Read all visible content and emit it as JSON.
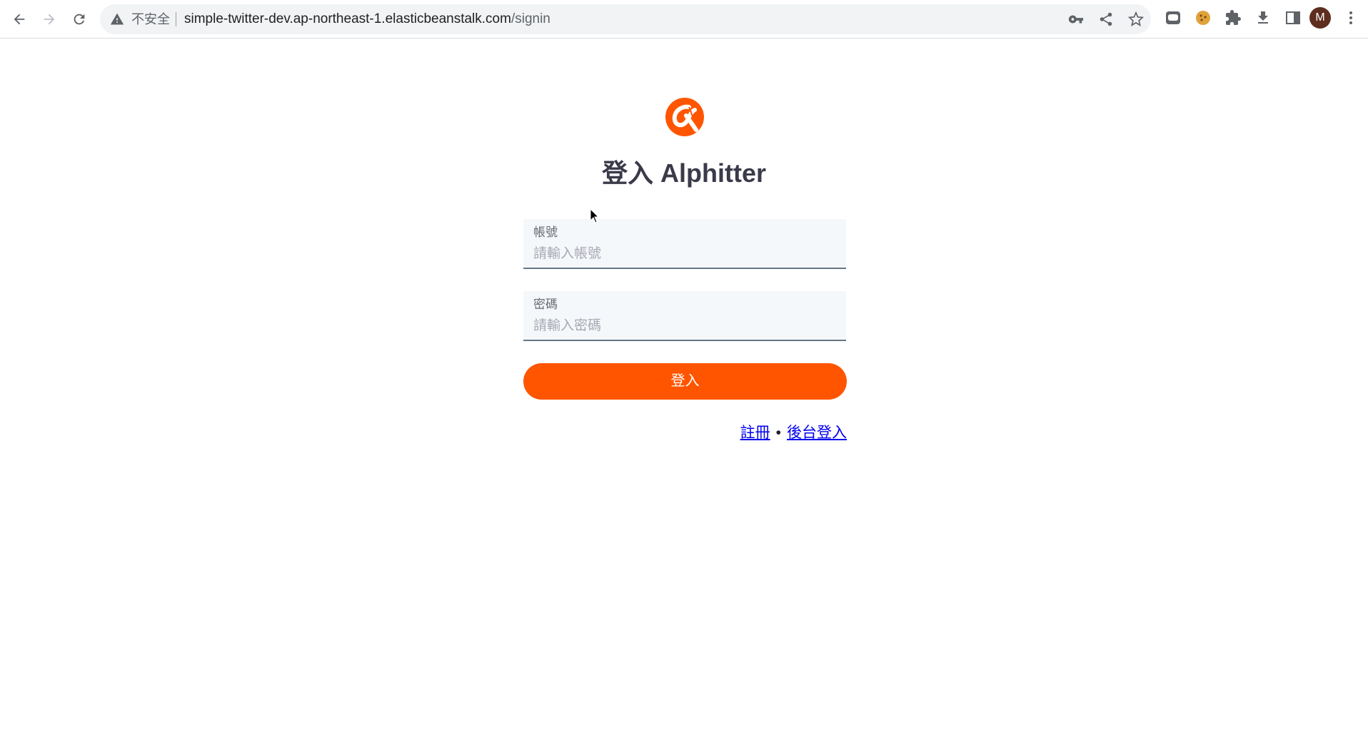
{
  "browser": {
    "security_label": "不安全",
    "url_host": "simple-twitter-dev.ap-northeast-1.elasticbeanstalk.com",
    "url_path": "/signin",
    "profile_initial": "M"
  },
  "page": {
    "title": "登入 Alphitter",
    "account": {
      "label": "帳號",
      "placeholder": "請輸入帳號",
      "value": ""
    },
    "password": {
      "label": "密碼",
      "placeholder": "請輸入密碼",
      "value": ""
    },
    "login_button": "登入",
    "links": {
      "signup": "註冊",
      "separator": "•",
      "admin_login": "後台登入"
    }
  },
  "colors": {
    "brand": "#ff5500",
    "title": "#3a3a4a",
    "link": "#0000ee"
  }
}
